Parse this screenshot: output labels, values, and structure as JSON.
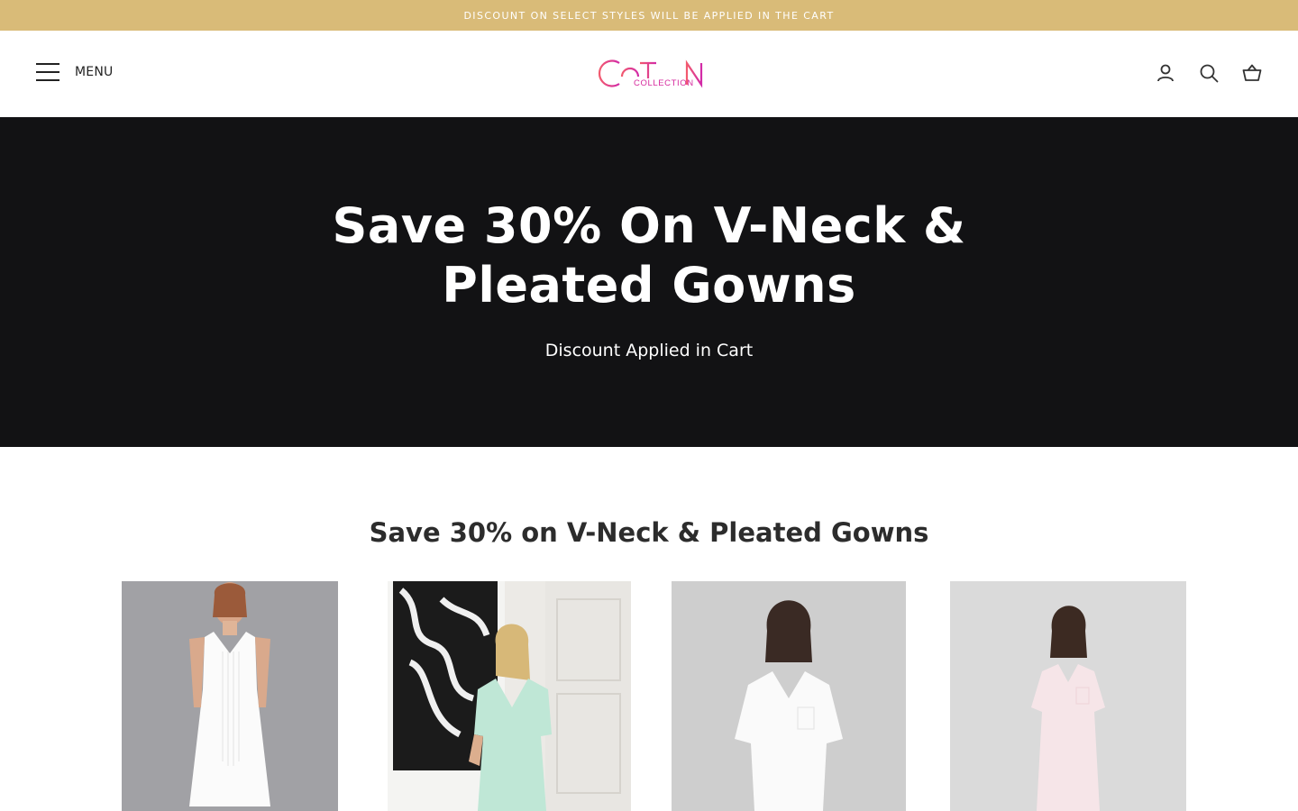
{
  "announcement": {
    "text": "DISCOUNT ON SELECT STYLES WILL BE APPLIED IN THE CART"
  },
  "header": {
    "menu_label": "MENU",
    "logo_text": "COTN",
    "logo_subtext": "COLLECTION",
    "icons": [
      "account-icon",
      "search-icon",
      "cart-icon"
    ]
  },
  "hero": {
    "title_line1": "Save 30% On V-Neck &",
    "title_line2": "Pleated Gowns",
    "subtitle": "Discount Applied in Cart"
  },
  "collection": {
    "title": "Save 30% on V-Neck & Pleated Gowns"
  },
  "colors": {
    "announcement_bg": "#d9bb78",
    "hero_bg": "#121214",
    "logo_pink": "#e8407e",
    "logo_magenta": "#d62a9e"
  }
}
